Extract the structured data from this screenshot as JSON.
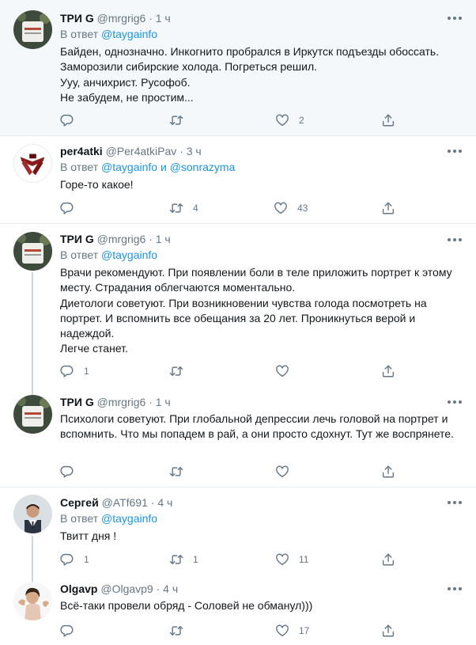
{
  "tweets": [
    {
      "name": "ТРИ G",
      "handle": "@mrgrig6",
      "dot": "·",
      "time": "1 ч",
      "reply_prefix": "В ответ",
      "reply_user1": "@taygainfo",
      "reply_and": "",
      "reply_user2": "",
      "text": "Байден, однозначно. Инкогнито пробрался в Иркутск подъезды обоссать. Заморозили сибирские холода. Погреться решил.\nУуу, анчихрист. Русофоб.\nНе забудем, не простим...",
      "replies": "",
      "retweets": "",
      "likes": "2"
    },
    {
      "name": "per4atki",
      "handle": "@Per4atkiPav",
      "dot": "·",
      "time": "3 ч",
      "reply_prefix": "В ответ",
      "reply_user1": "@taygainfo",
      "reply_and": "и",
      "reply_user2": "@sonrazyma",
      "text": "Горе-то какое!",
      "replies": "",
      "retweets": "4",
      "likes": "43"
    },
    {
      "name": "ТРИ G",
      "handle": "@mrgrig6",
      "dot": "·",
      "time": "1 ч",
      "reply_prefix": "В ответ",
      "reply_user1": "@taygainfo",
      "reply_and": "",
      "reply_user2": "",
      "text": "Врачи рекомендуют. При появлении боли в теле приложить портрет к этому месту. Страдания облегчаются моментально.\nДиетологи советуют. При возникновении чувства голода посмотреть на портрет. И вспомнить все обещания за 20 лет. Проникнуться верой и надеждой.\nЛегче станет.",
      "replies": "1",
      "retweets": "",
      "likes": ""
    },
    {
      "name": "ТРИ G",
      "handle": "@mrgrig6",
      "dot": "·",
      "time": "1 ч",
      "text": "Психологи советуют. При глобальной депрессии лечь головой на портрет и вспомнить. Что мы попадем в рай, а они просто сдохнут. Тут же воспрянете.",
      "replies": "",
      "retweets": "",
      "likes": ""
    },
    {
      "name": "Сергей",
      "handle": "@ATf691",
      "dot": "·",
      "time": "4 ч",
      "reply_prefix": "В ответ",
      "reply_user1": "@taygainfo",
      "reply_and": "",
      "reply_user2": "",
      "text": "Твитт дня !",
      "replies": "1",
      "retweets": "1",
      "likes": "11"
    },
    {
      "name": "Olgavp",
      "handle": "@Olgavp9",
      "dot": "·",
      "time": "4 ч",
      "text": "Всё-таки провели обряд - Соловей не обманул)))",
      "replies": "",
      "retweets": "",
      "likes": "17"
    }
  ],
  "colors": {
    "link": "#1b95e0",
    "muted": "#657786",
    "highlight_bg": "#f5f8fa",
    "divider": "#e6ecf0"
  },
  "icons": [
    "reply-icon",
    "retweet-icon",
    "like-icon",
    "share-icon",
    "more-icon"
  ]
}
